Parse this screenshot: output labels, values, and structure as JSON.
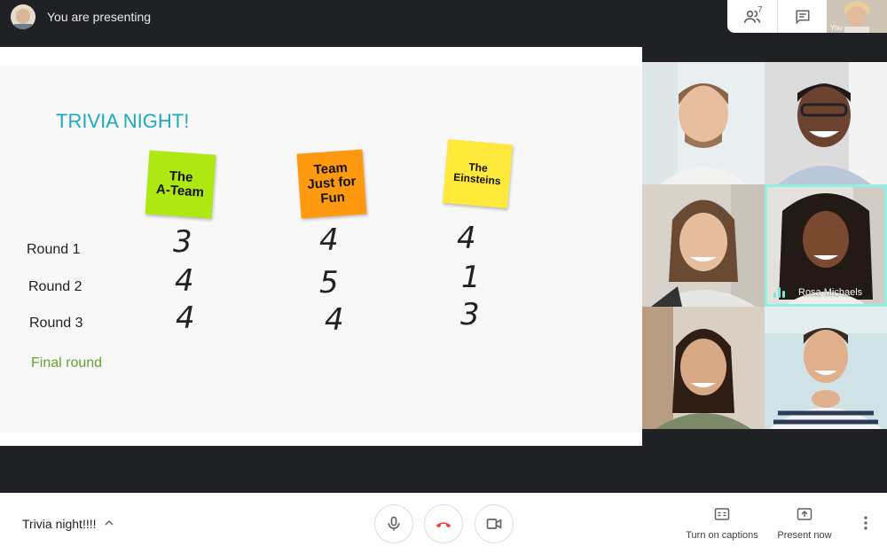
{
  "top_bar": {
    "presenting_label": "You are presenting",
    "people_count": "7",
    "self_label": "You"
  },
  "slide": {
    "title": "TRIVIA NIGHT!",
    "teams": [
      {
        "lines": [
          "The",
          "A-Team"
        ],
        "color": "#aee812"
      },
      {
        "lines": [
          "Team",
          "Just for",
          "Fun"
        ],
        "color": "#ff9a10"
      },
      {
        "lines": [
          "The",
          "Einsteins"
        ],
        "color": "#ffe93b"
      }
    ],
    "rounds": [
      {
        "label": "Round 1",
        "scores": [
          "3",
          "4",
          "4"
        ]
      },
      {
        "label": "Round 2",
        "scores": [
          "4",
          "5",
          "1"
        ]
      },
      {
        "label": "Round 3",
        "scores": [
          "4",
          "4",
          "3"
        ]
      }
    ],
    "final_round_label": "Final round",
    "title_color": "#1ea9bf",
    "final_round_color": "#67a32c"
  },
  "participants": {
    "speaking_name": "Rosa Michaels",
    "speaking_color": "#8ef0e0"
  },
  "bottom_bar": {
    "meeting_title": "Trivia night!!!!",
    "captions_label": "Turn on captions",
    "present_label": "Present now",
    "end_call_color": "#ea4335"
  }
}
